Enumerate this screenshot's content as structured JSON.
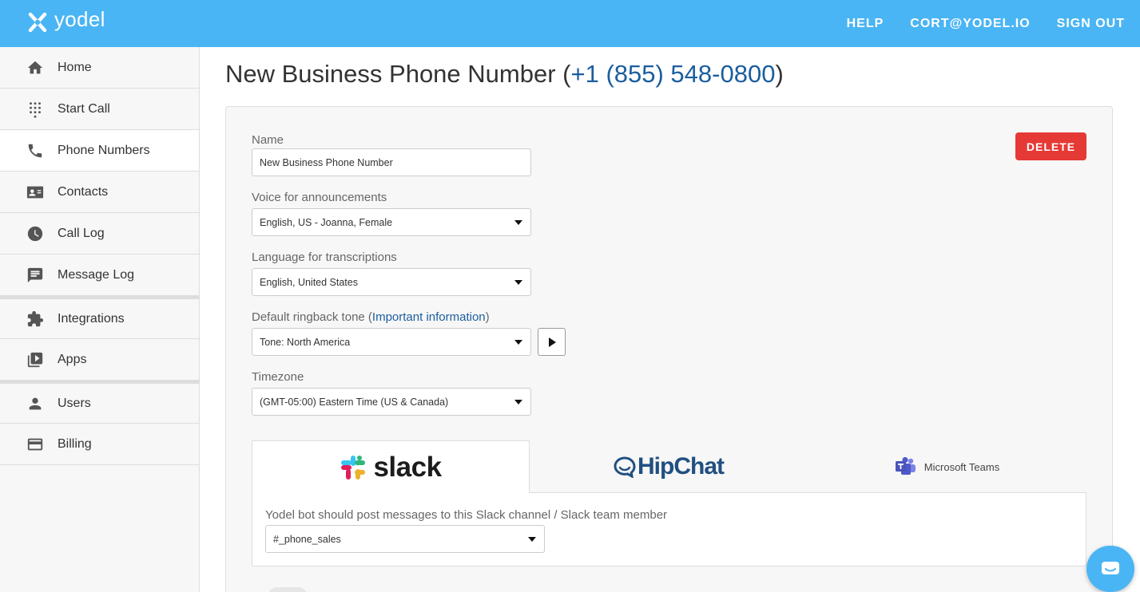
{
  "app": {
    "logo_text": "yodel"
  },
  "topnav": {
    "help": "HELP",
    "account": "CORT@YODEL.IO",
    "signout": "SIGN OUT"
  },
  "sidebar": {
    "items": [
      {
        "label": "Home",
        "icon": "home-icon"
      },
      {
        "label": "Start Call",
        "icon": "dialpad-icon"
      },
      {
        "label": "Phone Numbers",
        "icon": "phone-icon",
        "active": true
      },
      {
        "label": "Contacts",
        "icon": "contact-card-icon"
      },
      {
        "label": "Call Log",
        "icon": "clock-icon"
      },
      {
        "label": "Message Log",
        "icon": "message-icon"
      },
      {
        "label": "Integrations",
        "icon": "puzzle-icon"
      },
      {
        "label": "Apps",
        "icon": "apps-icon"
      },
      {
        "label": "Users",
        "icon": "user-icon"
      },
      {
        "label": "Billing",
        "icon": "credit-card-icon"
      }
    ]
  },
  "page": {
    "title_prefix": "New Business Phone Number (",
    "phone_number": "+1 (855) 548-0800",
    "title_suffix": ")"
  },
  "form": {
    "delete_label": "DELETE",
    "name": {
      "label": "Name",
      "value": "New Business Phone Number"
    },
    "voice": {
      "label": "Voice for announcements",
      "value": "English, US - Joanna, Female"
    },
    "language": {
      "label": "Language for transcriptions",
      "value": "English, United States"
    },
    "ringback": {
      "label_prefix": "Default ringback tone (",
      "link_text": "Important information",
      "label_suffix": ")",
      "value": "Tone: North America"
    },
    "timezone": {
      "label": "Timezone",
      "value": "(GMT-05:00) Eastern Time (US & Canada)"
    }
  },
  "integrations": {
    "tabs": [
      {
        "label": "slack",
        "active": true
      },
      {
        "label": "HipChat"
      },
      {
        "label": "Microsoft Teams"
      }
    ],
    "slack_panel": {
      "label": "Yodel bot should post messages to this Slack channel / Slack team member",
      "value": "#_phone_sales"
    }
  },
  "colors": {
    "header": "#4ab5f4",
    "accent_link": "#1b5e9e",
    "delete": "#e53935"
  }
}
